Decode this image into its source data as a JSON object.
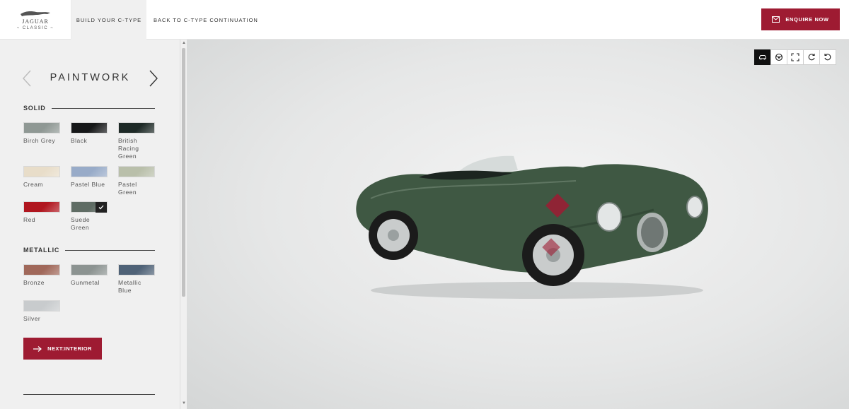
{
  "header": {
    "logo_word": "JAGUAR",
    "logo_sub": "~ CLASSIC ~",
    "tabs": [
      {
        "label": "BUILD YOUR C-TYPE",
        "active": true
      },
      {
        "label": "BACK TO C-TYPE CONTINUATION",
        "active": false
      }
    ],
    "enquire_label": "ENQUIRE NOW",
    "enquire_icon": "envelope-icon"
  },
  "sidebar": {
    "section_title": "PAINTWORK",
    "groups": [
      {
        "title": "SOLID",
        "swatches": [
          {
            "name": "Birch Grey",
            "color": "#8f9894",
            "selected": false
          },
          {
            "name": "Black",
            "color": "#161819",
            "selected": false
          },
          {
            "name": "British Racing Green",
            "color": "#1e2a27",
            "selected": false
          },
          {
            "name": "Cream",
            "color": "#e8ddc9",
            "selected": false
          },
          {
            "name": "Pastel Blue",
            "color": "#98abc8",
            "selected": false
          },
          {
            "name": "Pastel Green",
            "color": "#b9bfaa",
            "selected": false
          },
          {
            "name": "Red",
            "color": "#b0161f",
            "selected": false
          },
          {
            "name": "Suede Green",
            "color": "#5f6c64",
            "selected": true
          }
        ]
      },
      {
        "title": "METALLIC",
        "swatches": [
          {
            "name": "Bronze",
            "color": "#a0685a",
            "selected": false
          },
          {
            "name": "Gunmetal",
            "color": "#8c9391",
            "selected": false
          },
          {
            "name": "Metallic Blue",
            "color": "#4f6277",
            "selected": false
          },
          {
            "name": "Silver",
            "color": "#c8cbcd",
            "selected": false
          }
        ]
      }
    ],
    "next_label": "NEXT:INTERIOR"
  },
  "viewer": {
    "toolbar": [
      {
        "icon": "car-exterior-icon",
        "active": true
      },
      {
        "icon": "steering-wheel-icon",
        "active": false
      },
      {
        "icon": "fullscreen-icon",
        "active": false
      },
      {
        "icon": "rotate-right-icon",
        "active": false
      },
      {
        "icon": "rotate-left-icon",
        "active": false
      }
    ],
    "car_color": "#3f5843"
  },
  "colors": {
    "accent": "#9e1b32",
    "panel": "#f0f0f0"
  }
}
